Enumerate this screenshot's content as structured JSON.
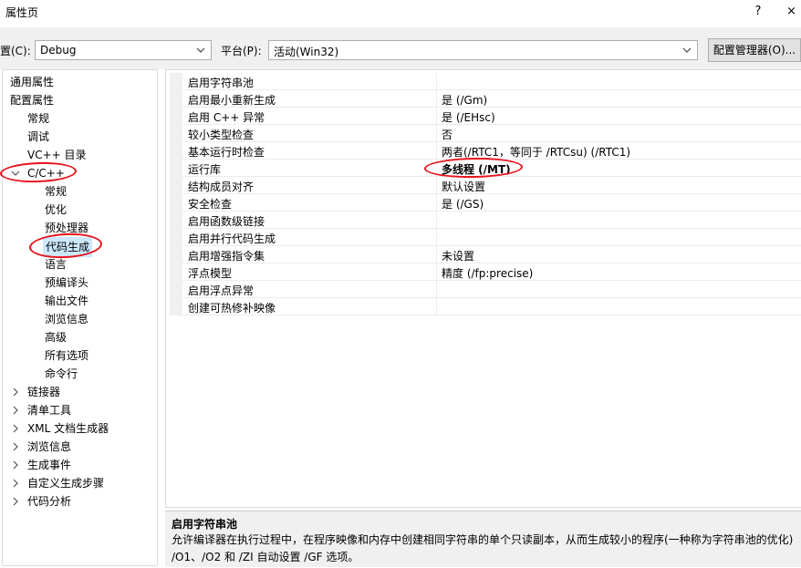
{
  "window": {
    "title": "属性页",
    "help_glyph": "?",
    "close_glyph": "×"
  },
  "toolbar": {
    "config_label": "置(C):",
    "config_value": "Debug",
    "platform_label": "平台(P):",
    "platform_value": "活动(Win32)",
    "manager_button": "配置管理器(O)..."
  },
  "tree": {
    "items": [
      {
        "label": "通用属性",
        "level": 0,
        "expander": "none"
      },
      {
        "label": "配置属性",
        "level": 0,
        "expander": "none"
      },
      {
        "label": "常规",
        "level": 1,
        "expander": "none"
      },
      {
        "label": "调试",
        "level": 1,
        "expander": "none"
      },
      {
        "label": "VC++ 目录",
        "level": 1,
        "expander": "none"
      },
      {
        "label": "C/C++",
        "level": 1,
        "expander": "expanded"
      },
      {
        "label": "常规",
        "level": 2,
        "expander": "none"
      },
      {
        "label": "优化",
        "level": 2,
        "expander": "none"
      },
      {
        "label": "预处理器",
        "level": 2,
        "expander": "none"
      },
      {
        "label": "代码生成",
        "level": 2,
        "expander": "none",
        "selected": true
      },
      {
        "label": "语言",
        "level": 2,
        "expander": "none"
      },
      {
        "label": "预编译头",
        "level": 2,
        "expander": "none"
      },
      {
        "label": "输出文件",
        "level": 2,
        "expander": "none"
      },
      {
        "label": "浏览信息",
        "level": 2,
        "expander": "none"
      },
      {
        "label": "高级",
        "level": 2,
        "expander": "none"
      },
      {
        "label": "所有选项",
        "level": 2,
        "expander": "none"
      },
      {
        "label": "命令行",
        "level": 2,
        "expander": "none"
      },
      {
        "label": "链接器",
        "level": 1,
        "expander": "collapsed"
      },
      {
        "label": "清单工具",
        "level": 1,
        "expander": "collapsed"
      },
      {
        "label": "XML 文档生成器",
        "level": 1,
        "expander": "collapsed"
      },
      {
        "label": "浏览信息",
        "level": 1,
        "expander": "collapsed"
      },
      {
        "label": "生成事件",
        "level": 1,
        "expander": "collapsed"
      },
      {
        "label": "自定义生成步骤",
        "level": 1,
        "expander": "collapsed"
      },
      {
        "label": "代码分析",
        "level": 1,
        "expander": "collapsed"
      }
    ]
  },
  "properties": [
    {
      "name": "启用字符串池",
      "value": ""
    },
    {
      "name": "启用最小重新生成",
      "value": "是 (/Gm)"
    },
    {
      "name": "启用 C++ 异常",
      "value": "是 (/EHsc)"
    },
    {
      "name": "较小类型检查",
      "value": "否"
    },
    {
      "name": "基本运行时检查",
      "value": "两者(/RTC1，等同于 /RTCsu) (/RTC1)"
    },
    {
      "name": "运行库",
      "value": "多线程 (/MT)",
      "bold": true
    },
    {
      "name": "结构成员对齐",
      "value": "默认设置"
    },
    {
      "name": "安全检查",
      "value": "是 (/GS)"
    },
    {
      "name": "启用函数级链接",
      "value": ""
    },
    {
      "name": "启用并行代码生成",
      "value": ""
    },
    {
      "name": "启用增强指令集",
      "value": "未设置"
    },
    {
      "name": "浮点模型",
      "value": "精度 (/fp:precise)"
    },
    {
      "name": "启用浮点异常",
      "value": ""
    },
    {
      "name": "创建可热修补映像",
      "value": ""
    }
  ],
  "description": {
    "title": "启用字符串池",
    "text": "允许编译器在执行过程中，在程序映像和内存中创建相同字符串的单个只读副本，从而生成较小的程序(一种称为字符串池的优化) /O1、/O2 和 /ZI 自动设置 /GF 选项。"
  },
  "annotations": {
    "color": "#e8141c"
  },
  "icons": {
    "dropdown": "chevron-down-icon",
    "expanded": "chevron-down-icon",
    "collapsed": "chevron-right-icon"
  }
}
